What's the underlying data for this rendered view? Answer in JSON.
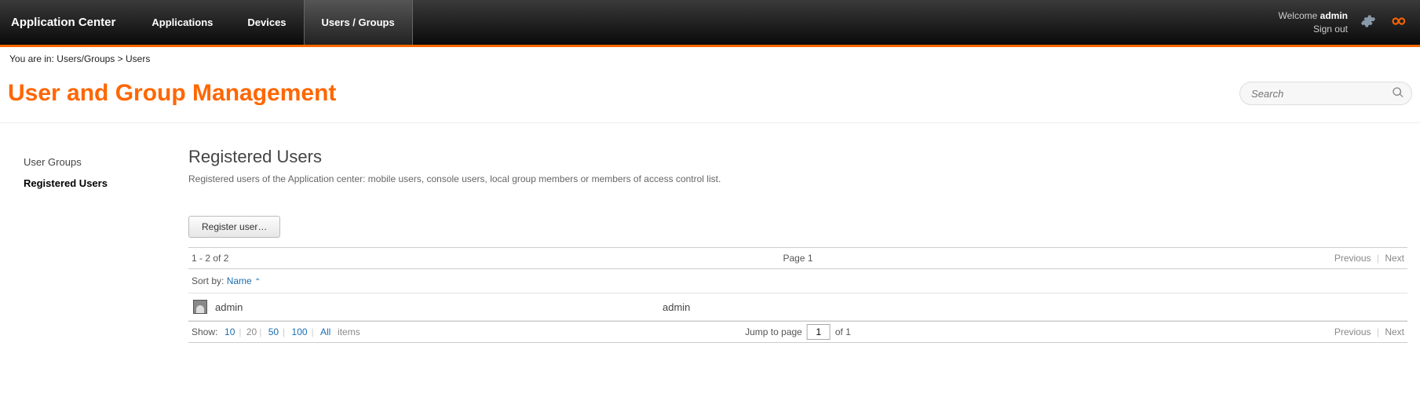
{
  "header": {
    "app_title": "Application Center",
    "tabs": [
      {
        "label": "Applications"
      },
      {
        "label": "Devices"
      },
      {
        "label": "Users / Groups"
      }
    ],
    "welcome_prefix": "Welcome ",
    "username": "admin",
    "sign_out": "Sign out"
  },
  "breadcrumb": {
    "prefix": "You are in: ",
    "path": "Users/Groups > Users"
  },
  "page": {
    "title": "User and Group Management",
    "search_placeholder": "Search"
  },
  "sidebar": {
    "items": [
      {
        "label": "User Groups",
        "selected": false
      },
      {
        "label": "Registered Users",
        "selected": true
      }
    ]
  },
  "section": {
    "title": "Registered Users",
    "description": "Registered users of the Application center: mobile users, console users, local group members or members of access control list.",
    "register_button": "Register user…"
  },
  "pager_top": {
    "range": "1 - 2 of 2",
    "page_label": "Page 1",
    "prev": "Previous",
    "next": "Next"
  },
  "sort": {
    "label": "Sort by: ",
    "column": "Name",
    "arrow": "⌃"
  },
  "rows": [
    {
      "name": "admin",
      "display": "admin"
    }
  ],
  "footer": {
    "show_label": "Show:",
    "opts": [
      "10",
      "20",
      "50",
      "100",
      "All"
    ],
    "items_suffix": "items",
    "jump_label": "Jump to page",
    "jump_value": "1",
    "jump_suffix": "of 1",
    "prev": "Previous",
    "next": "Next"
  }
}
